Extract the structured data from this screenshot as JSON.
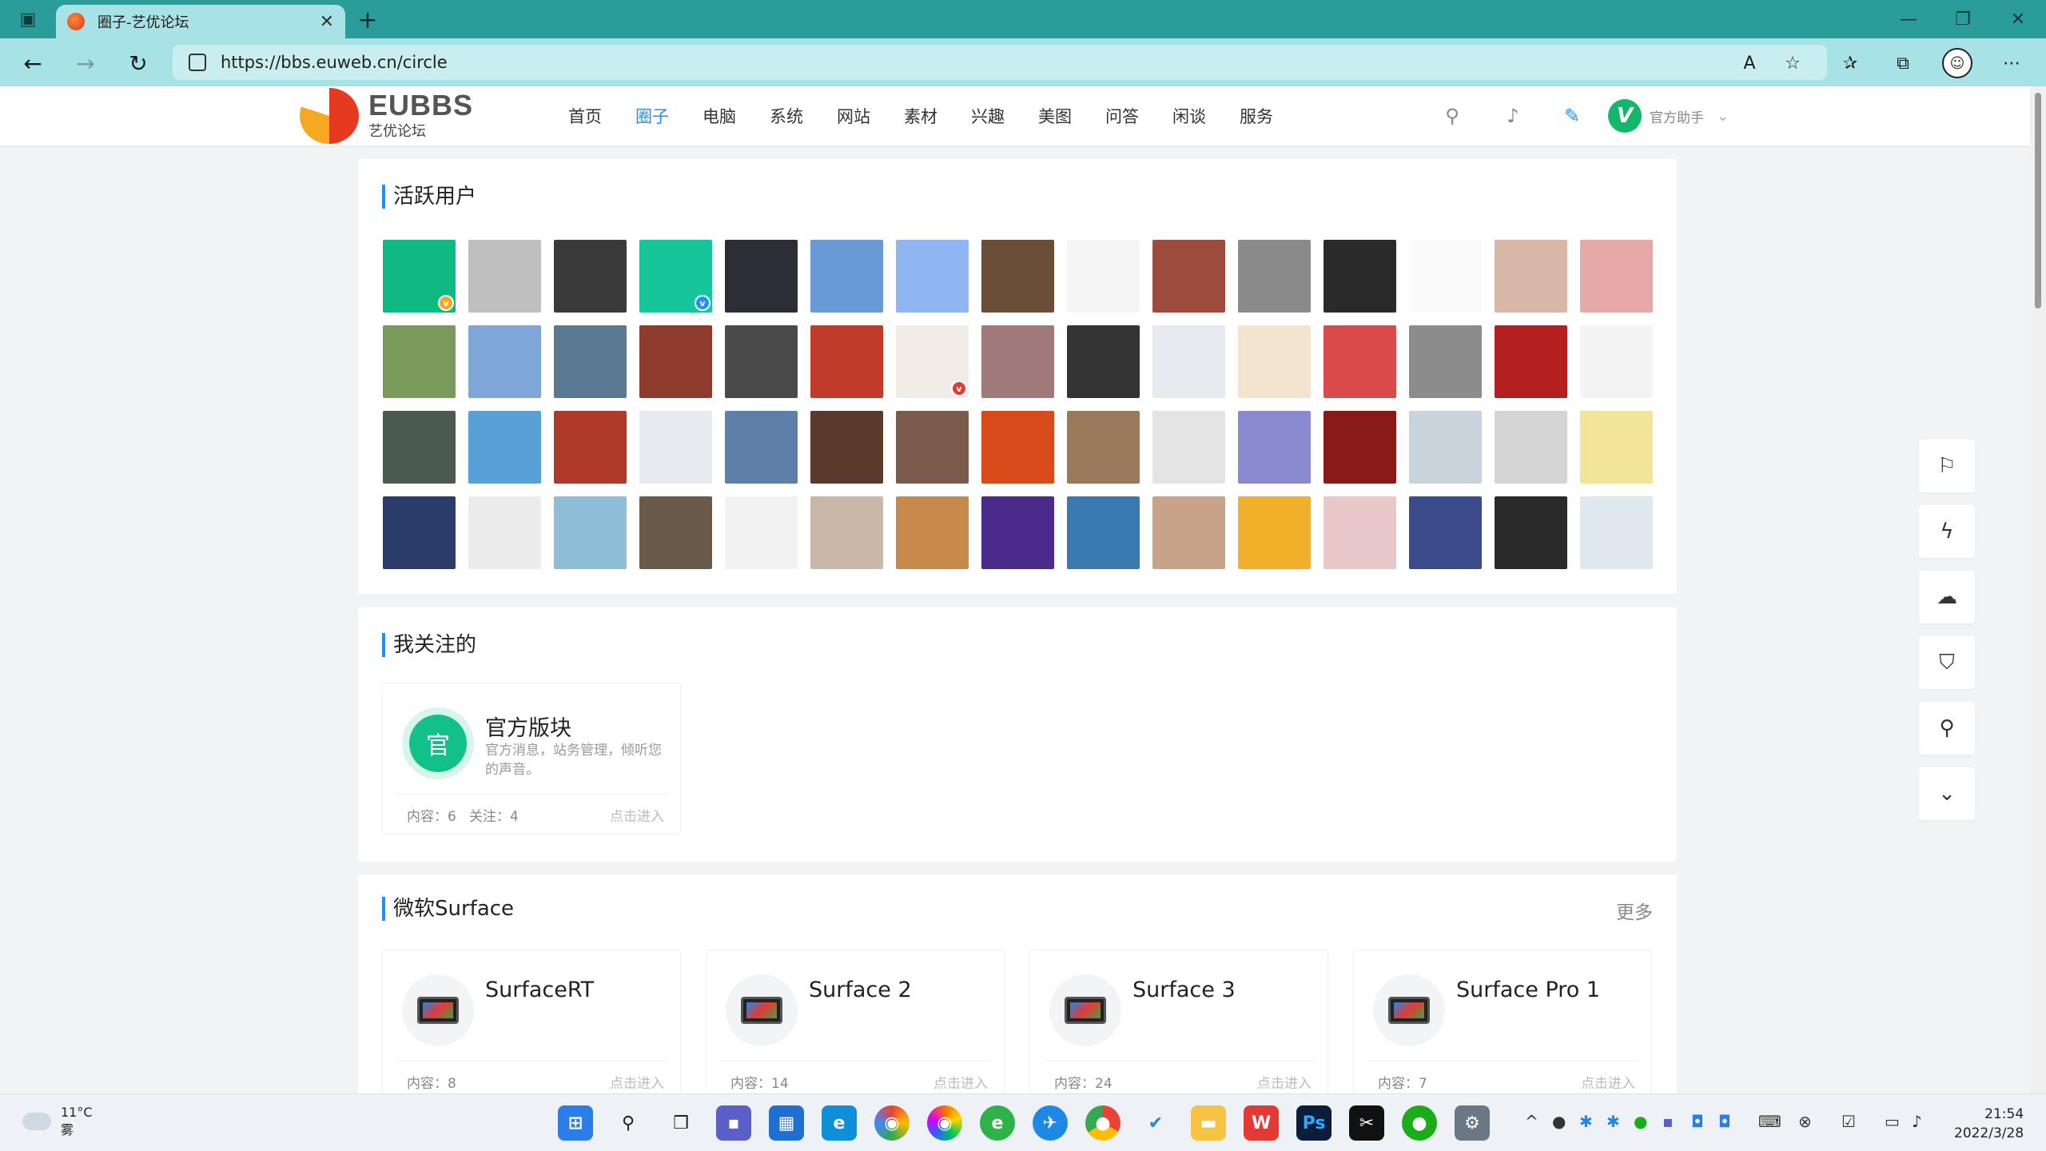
{
  "browser": {
    "tab_title": "圈子-艺优论坛",
    "url": "https://bbs.euweb.cn/circle",
    "new_tab_symbol": "+"
  },
  "site": {
    "logo_en": "EUBBS",
    "logo_cn": "艺优论坛",
    "nav": [
      "首页",
      "圈子",
      "电脑",
      "系统",
      "网站",
      "素材",
      "兴趣",
      "美图",
      "问答",
      "闲谈",
      "服务"
    ],
    "active_nav": "圈子",
    "user_initial": "V",
    "user_name": "官方助手"
  },
  "active_users": {
    "title": "活跃用户",
    "avatars": [
      {
        "c": "#10b981",
        "badge": "#f5a623"
      },
      {
        "c": "#bfbfbf"
      },
      {
        "c": "#3a3a3a"
      },
      {
        "c": "#16c59a",
        "badge": "#1e90ff"
      },
      {
        "c": "#2d2d35"
      },
      {
        "c": "#6a9ad6"
      },
      {
        "c": "#8fb6f0"
      },
      {
        "c": "#6b4e3a"
      },
      {
        "c": "#f5f5f5"
      },
      {
        "c": "#9c4b3c"
      },
      {
        "c": "#8a8a8a"
      },
      {
        "c": "#2a2a2a"
      },
      {
        "c": "#fafafa"
      },
      {
        "c": "#d9b7a6"
      },
      {
        "c": "#e7a8a8"
      },
      {
        "c": "#7a9a5c"
      },
      {
        "c": "#7ea6d9"
      },
      {
        "c": "#5a7a94"
      },
      {
        "c": "#8e3a2c"
      },
      {
        "c": "#4a4a4a"
      },
      {
        "c": "#c23a2a"
      },
      {
        "c": "#f1ede6",
        "badge": "#e53935"
      },
      {
        "c": "#a07a7a"
      },
      {
        "c": "#333"
      },
      {
        "c": "#e8eaf0"
      },
      {
        "c": "#f3e4d0"
      },
      {
        "c": "#d94a4a"
      },
      {
        "c": "#8c8c8c"
      },
      {
        "c": "#b3201f"
      },
      {
        "c": "#f4f4f4"
      },
      {
        "c": "#4a5a52"
      },
      {
        "c": "#5aa0d8"
      },
      {
        "c": "#b03a2a"
      },
      {
        "c": "#e8eaf0"
      },
      {
        "c": "#5d7fa8"
      },
      {
        "c": "#5a3a2a"
      },
      {
        "c": "#7a5a4a"
      },
      {
        "c": "#d84a1a"
      },
      {
        "c": "#9a7a5a"
      },
      {
        "c": "#e4e4e4"
      },
      {
        "c": "#8a8ad0"
      },
      {
        "c": "#8a1a1a"
      },
      {
        "c": "#c9d3dc"
      },
      {
        "c": "#d4d4d4"
      },
      {
        "c": "#f2e59a"
      },
      {
        "c": "#2b3b6a"
      },
      {
        "c": "#ececec"
      },
      {
        "c": "#8fbfd8"
      },
      {
        "c": "#6a5a4a"
      },
      {
        "c": "#f2f2f2"
      },
      {
        "c": "#c9b8a8"
      },
      {
        "c": "#c88a4a"
      },
      {
        "c": "#4a2a8a"
      },
      {
        "c": "#3a7ab0"
      },
      {
        "c": "#c9a28a"
      },
      {
        "c": "#f2b02a"
      },
      {
        "c": "#e8c8c8"
      },
      {
        "c": "#3a4a8a"
      },
      {
        "c": "#2a2a2a"
      },
      {
        "c": "#dfe8ee"
      }
    ]
  },
  "following": {
    "title": "我关注的",
    "card": {
      "icon_text": "官",
      "name": "官方版块",
      "desc": "官方消息，站务管理，倾听您的声音。",
      "content": "内容：6",
      "follow": "关注：4",
      "enter": "点击进入"
    }
  },
  "surface": {
    "title": "微软Surface",
    "more": "更多",
    "cards": [
      {
        "name": "SurfaceRT",
        "content": "内容：8",
        "enter": "点击进入"
      },
      {
        "name": "Surface 2",
        "content": "内容：14",
        "enter": "点击进入"
      },
      {
        "name": "Surface 3",
        "content": "内容：24",
        "enter": "点击进入"
      },
      {
        "name": "Surface Pro 1",
        "content": "内容：7",
        "enter": "点击进入"
      }
    ]
  },
  "taskbar": {
    "temp": "11°C",
    "weather": "雾",
    "time": "21:54",
    "date": "2022/3/28"
  }
}
